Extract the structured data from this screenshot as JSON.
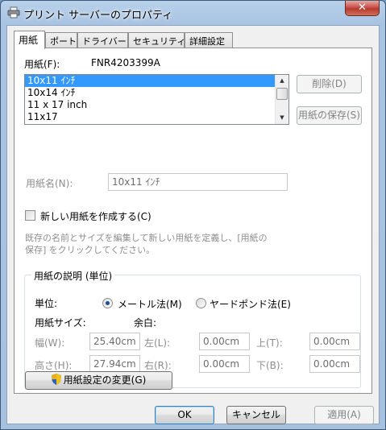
{
  "window": {
    "title": "プリント サーバーのプロパティ",
    "close_label": "✕"
  },
  "tabs": [
    {
      "label": "用紙",
      "active": true
    },
    {
      "label": "ポート",
      "active": false
    },
    {
      "label": "ドライバー",
      "active": false
    },
    {
      "label": "セキュリティ",
      "active": false
    },
    {
      "label": "詳細設定",
      "active": false
    }
  ],
  "forms": {
    "label": "用紙(F):",
    "server_name": "FNR4203399A",
    "items": [
      "10x11 ｲﾝﾁ",
      "10x14 ｲﾝﾁ",
      "11 x 17 inch",
      "11x17"
    ],
    "selected_index": 0,
    "delete_label": "削除(D)",
    "save_label": "用紙の保存(S)"
  },
  "form_name": {
    "label": "用紙名(N):",
    "value": "10x11 ｲﾝﾁ"
  },
  "create_new": {
    "label": "新しい用紙を作成する(C)",
    "checked": false,
    "hint_line1": "既存の名前とサイズを編集して新しい用紙を定義し、[用紙の",
    "hint_line2": "保存] をクリックしてください。"
  },
  "description": {
    "title": "用紙の説明 (単位)",
    "units_label": "単位:",
    "metric_label": "メートル法(M)",
    "english_label": "ヤードポンド法(E)",
    "selected_unit": "metric",
    "paper_size_label": "用紙サイズ:",
    "margins_label": "余白:",
    "width_label": "幅(W):",
    "width_value": "25.40cm",
    "height_label": "高さ(H):",
    "height_value": "27.94cm",
    "left_label": "左(L):",
    "left_value": "0.00cm",
    "right_label": "右(R):",
    "right_value": "0.00cm",
    "top_label": "上(T):",
    "top_value": "0.00cm",
    "bottom_label": "下(B):",
    "bottom_value": "0.00cm"
  },
  "change_settings_label": "用紙設定の変更(G)",
  "dialog_buttons": {
    "ok": "OK",
    "cancel": "キャンセル",
    "apply": "適用(A)"
  }
}
